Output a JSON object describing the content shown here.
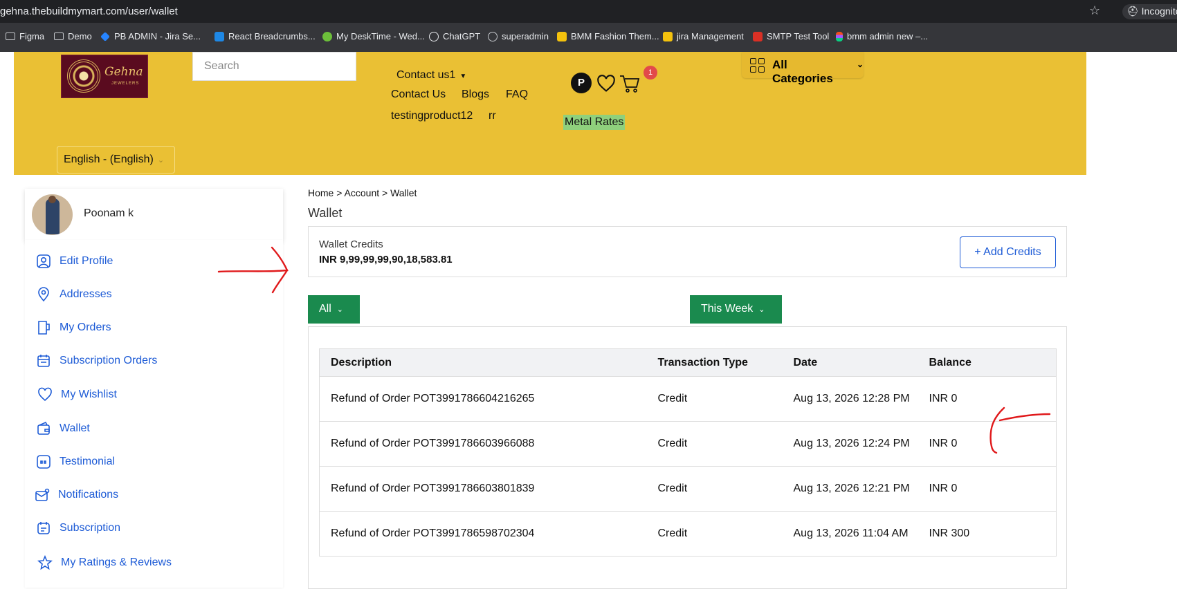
{
  "browser": {
    "url": "gehna.thebuildmymart.com/user/wallet",
    "incognito_label": "Incognito",
    "bookmarks": [
      "Figma",
      "Demo",
      "PB ADMIN - Jira Se...",
      "React Breadcrumbs...",
      "My DeskTime - Wed...",
      "ChatGPT",
      "superadmin",
      "BMM Fashion Them...",
      "jira Management",
      "SMTP Test Tool",
      "bmm admin new –..."
    ]
  },
  "header": {
    "logo_brand": "Gehna",
    "logo_sub": "JEWELERS",
    "search_placeholder": "Search",
    "contact_dropdown": "Contact us1",
    "nav_links": [
      "Contact Us",
      "Blogs",
      "FAQ"
    ],
    "nav_links_row2": [
      "testingproduct12",
      "rr"
    ],
    "metal_rates": "Metal Rates",
    "profile_initial": "P",
    "cart_count": "1",
    "all_categories": "All Categories",
    "language": "English - (English)"
  },
  "sidebar": {
    "user_name": "Poonam k",
    "items": [
      {
        "label": "Edit Profile",
        "icon": "user-icon"
      },
      {
        "label": "Addresses",
        "icon": "location-pin-icon"
      },
      {
        "label": "My Orders",
        "icon": "orders-icon"
      },
      {
        "label": "Subscription Orders",
        "icon": "calendar-icon"
      },
      {
        "label": "My Wishlist",
        "icon": "heart-icon"
      },
      {
        "label": "Wallet",
        "icon": "wallet-icon"
      },
      {
        "label": "Testimonial",
        "icon": "quote-icon"
      },
      {
        "label": "Notifications",
        "icon": "envelope-icon"
      },
      {
        "label": "Subscription",
        "icon": "calendar-check-icon"
      },
      {
        "label": "My Ratings & Reviews",
        "icon": "star-icon"
      }
    ]
  },
  "main": {
    "breadcrumb": "Home > Account > Wallet",
    "title": "Wallet",
    "wallet_label": "Wallet Credits",
    "wallet_amount": "INR 9,99,99,99,90,18,583.81",
    "add_credits": "+ Add Credits",
    "filter_type": "All",
    "filter_period": "This Week",
    "table": {
      "headers": [
        "Description",
        "Transaction Type",
        "Date",
        "Balance"
      ],
      "rows": [
        [
          "Refund of Order POT3991786604216265",
          "Credit",
          "Aug 13, 2026 12:28 PM",
          "INR 0"
        ],
        [
          "Refund of Order POT3991786603966088",
          "Credit",
          "Aug 13, 2026 12:24 PM",
          "INR 0"
        ],
        [
          "Refund of Order POT3991786603801839",
          "Credit",
          "Aug 13, 2026 12:21 PM",
          "INR 0"
        ],
        [
          "Refund of Order POT3991786598702304",
          "Credit",
          "Aug 13, 2026 11:04 AM",
          "INR 300"
        ]
      ]
    }
  },
  "colors": {
    "header_bg": "#eac034",
    "link_blue": "#1d5bd6",
    "filter_green": "#1a8a4e",
    "metal_rates_bg": "#8fd07c",
    "annotation_red": "#e0191b"
  }
}
